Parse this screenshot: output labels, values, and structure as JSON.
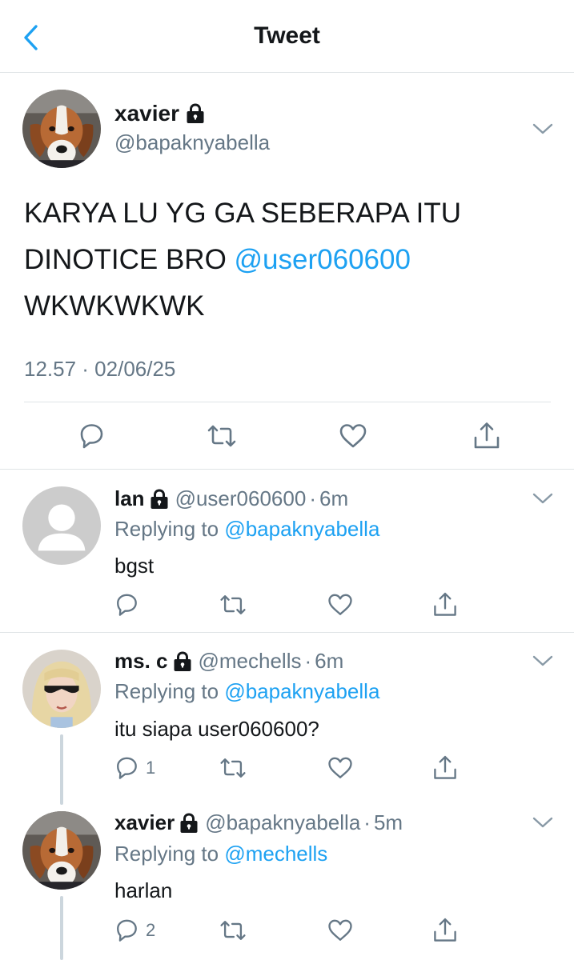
{
  "header": {
    "title": "Tweet",
    "back_icon": "chevron-left-icon"
  },
  "colors": {
    "accent": "#1da1f2",
    "secondary_text": "#657786",
    "divider": "#dfe3e6"
  },
  "main_tweet": {
    "name": "xavier",
    "handle": "@bapaknyabella",
    "text_before": "KARYA LU YG GA SEBERAPA ITU DINOTICE BRO ",
    "mention": "@user060600",
    "text_after": " WKWKWKWK",
    "timestamp": "12.57 · 02/06/25",
    "actions": [
      "reply-icon",
      "retweet-icon",
      "like-icon",
      "share-icon"
    ]
  },
  "replies": [
    {
      "name": "lan",
      "handle": "@user060600",
      "dot": "·",
      "time": "6m",
      "replying_label": "Replying to",
      "replying_to": "@bapaknyabella",
      "text": "bgst",
      "reply_count": ""
    },
    {
      "name": "ms. c",
      "handle": "@mechells",
      "dot": "·",
      "time": "6m",
      "replying_label": "Replying to",
      "replying_to": "@bapaknyabella",
      "text": "itu siapa user060600?",
      "reply_count": "1"
    },
    {
      "name": "xavier",
      "handle": "@bapaknyabella",
      "dot": "·",
      "time": "5m",
      "replying_label": "Replying to",
      "replying_to": "@mechells",
      "text": "harlan",
      "reply_count": "2"
    }
  ]
}
